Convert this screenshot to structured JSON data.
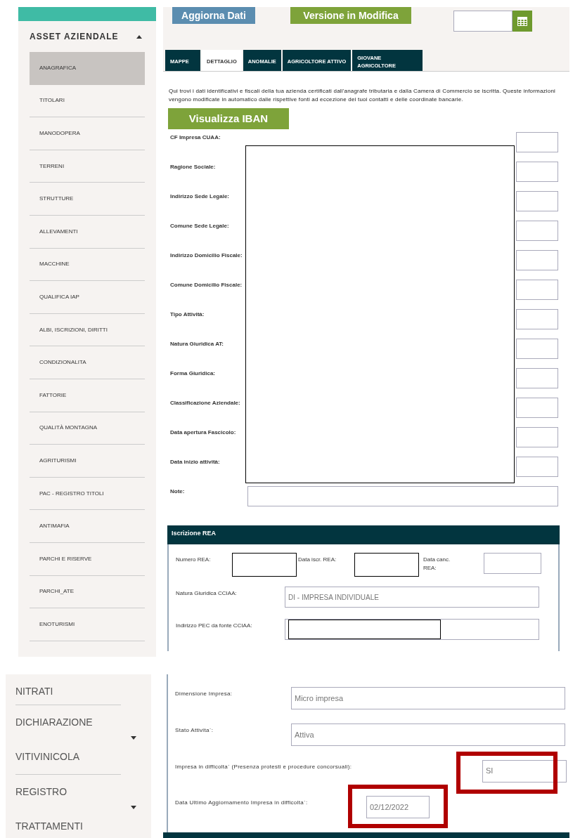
{
  "sidebar": {
    "group": {
      "label": "ASSET AZIENDALE",
      "expanded": true
    },
    "items": [
      {
        "label": "ANAGRAFICA",
        "selected": true
      },
      {
        "label": "TITOLARI",
        "selected": false
      },
      {
        "label": "MANODOPERA",
        "selected": false
      },
      {
        "label": "TERRENI",
        "selected": false
      },
      {
        "label": "STRUTTURE",
        "selected": false
      },
      {
        "label": "ALLEVAMENTI",
        "selected": false
      },
      {
        "label": "MACCHINE",
        "selected": false
      },
      {
        "label": "QUALIFICA IAP",
        "selected": false
      },
      {
        "label": "ALBI, ISCRIZIONI, DIRITTI",
        "selected": false
      },
      {
        "label": "CONDIZIONALITA",
        "selected": false
      },
      {
        "label": "FATTORIE",
        "selected": false
      },
      {
        "label": "QUALITÀ MONTAGNA",
        "selected": false
      },
      {
        "label": "AGRITURISMI",
        "selected": false
      },
      {
        "label": "PAC - REGISTRO TITOLI",
        "selected": false
      },
      {
        "label": "ANTIMAFIA",
        "selected": false
      },
      {
        "label": "PARCHI E RISERVE",
        "selected": false
      },
      {
        "label": "PARCHI_ATE",
        "selected": false
      },
      {
        "label": "ENOTURISMI",
        "selected": false
      }
    ]
  },
  "toolbar": {
    "buttons": [
      {
        "label": "Aggiorna Dati",
        "kind": "blue"
      },
      {
        "label": "Versione in Modifica",
        "kind": "green"
      }
    ]
  },
  "tabs": [
    {
      "label": "MAPPE",
      "selected": false
    },
    {
      "label": "DETTAGLIO",
      "selected": true
    },
    {
      "label": "ANOMALIE",
      "selected": false
    },
    {
      "label": "AGRICOLTORE ATTIVO",
      "selected": false
    },
    {
      "label": "GIOVANE AGRICOLTORE",
      "selected": false
    }
  ],
  "description": "Qui trovi i dati identificativi e fiscali della tua azienda certificati dall'anagrafe tributaria e dalla Camera di Commercio se iscritta. Queste informazioni vengono modificate in automatico dalle rispettive fonti ad eccezione dei tuoi contatti e delle coordinate bancarie.",
  "iban_button": "Visualizza IBAN",
  "form_fields": [
    {
      "label": "CF Impresa CUAA:",
      "kind": "covered"
    },
    {
      "label": "Ragione Sociale:",
      "kind": "covered"
    },
    {
      "label": "Indirizzo Sede Legale:",
      "kind": "covered"
    },
    {
      "label": "Comune Sede Legale:",
      "kind": "covered"
    },
    {
      "label": "Indirizzo Domicilio Fiscale:",
      "kind": "covered"
    },
    {
      "label": "Comune Domicilio Fiscale:",
      "kind": "covered"
    },
    {
      "label": "Tipo Attività:",
      "kind": "covered"
    },
    {
      "label": "Natura Giuridica AT:",
      "kind": "covered"
    },
    {
      "label": "Forma Giuridica:",
      "kind": "covered"
    },
    {
      "label": "Classificazione Aziendale:",
      "kind": "covered"
    },
    {
      "label": "Data apertura Fascicolo:",
      "kind": "covered"
    },
    {
      "label": "Data inizio attività:",
      "kind": "covered"
    },
    {
      "label": "Note:",
      "kind": "full"
    }
  ],
  "rea_section": {
    "title": "Iscrizione REA",
    "inline_fields": [
      {
        "label": "Numero REA:",
        "kind": "redacted"
      },
      {
        "label": "Data iscr. REA:",
        "kind": "redacted"
      },
      {
        "label": "Data canc. REA:",
        "kind": "input"
      }
    ],
    "fields": [
      {
        "label": "Natura Giuridica CCIAA:",
        "value": "DI - IMPRESA INDIVIDUALE",
        "kind": "input"
      },
      {
        "label": "Indirizzo PEC da fonte CCIAA:",
        "kind": "redacted"
      }
    ]
  },
  "lower_sidebar": [
    {
      "label": "NITRATI",
      "expandable": false
    },
    {
      "label": "DICHIARAZIONE VITIVINICOLA",
      "expandable": true
    },
    {
      "label": "REGISTRO TRATTAMENTI",
      "expandable": true
    }
  ],
  "lower_fields": [
    {
      "label": "Dimensione Impresa:",
      "value": "Micro impresa",
      "kind": "wide",
      "highlighted": false
    },
    {
      "label": "Stato Attivita`:",
      "value": "Attiva",
      "kind": "wide",
      "highlighted": false
    },
    {
      "label": "Impresa in difficolta` (Presenza protesti e procedure concorsuali):",
      "value": "SI",
      "kind": "right",
      "highlighted": true
    },
    {
      "label": "Data Ultimo Aggiornamento Impresa in difficolta`:",
      "value": "02/12/2022",
      "kind": "date",
      "highlighted": true
    }
  ]
}
